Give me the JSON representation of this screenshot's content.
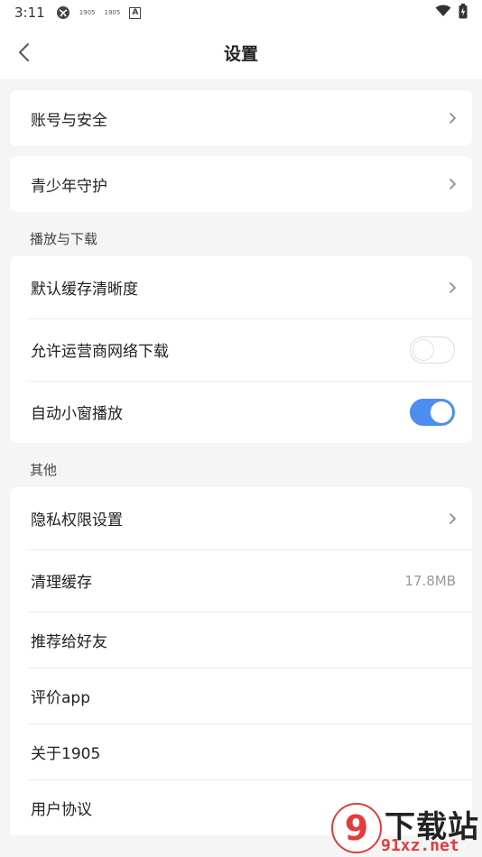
{
  "status_bar": {
    "time": "3:11",
    "mini_labels": [
      "1905",
      "1905"
    ],
    "a_badge": "A",
    "icons": [
      "vpn-icon",
      "wifi-icon",
      "battery-icon"
    ]
  },
  "header": {
    "title": "设置",
    "back_icon": "chevron-left-icon"
  },
  "groups": {
    "account": {
      "label": "账号与安全"
    },
    "youth": {
      "label": "青少年守护"
    },
    "playback": {
      "section_title": "播放与下载",
      "items": [
        {
          "label": "默认缓存清晰度",
          "control": "chevron"
        },
        {
          "label": "允许运营商网络下载",
          "control": "toggle",
          "on": false
        },
        {
          "label": "自动小窗播放",
          "control": "toggle",
          "on": true
        }
      ]
    },
    "other": {
      "section_title": "其他",
      "items": [
        {
          "label": "隐私权限设置",
          "control": "chevron"
        },
        {
          "label": "清理缓存",
          "value": "17.8MB"
        },
        {
          "label": "推荐给好友"
        },
        {
          "label": "评价app"
        },
        {
          "label": "关于1905"
        },
        {
          "label": "用户协议"
        }
      ]
    }
  },
  "colors": {
    "toggle_on": "#4d8df2",
    "background": "#f5f5f5",
    "card": "#ffffff"
  },
  "watermark": {
    "brand": "下载站",
    "site": "91xz.net",
    "logo_glyph": "9"
  }
}
